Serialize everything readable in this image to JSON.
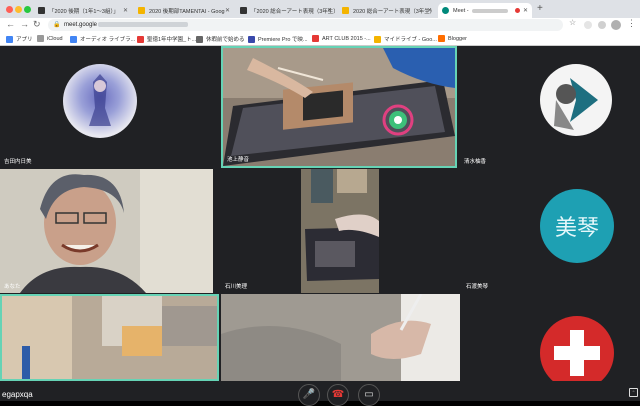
{
  "browser": {
    "tabs": [
      {
        "label": "「2020 後期（1年1〜3組）」",
        "color": "#1a73e8"
      },
      {
        "label": "2020 後期部TAMENTAI - Goog",
        "color": "#f4b400"
      },
      {
        "label": "「2020 総合ーアート表現（3年生）",
        "color": "#1a73e8"
      },
      {
        "label": "2020 総合ーアート表現（3年生）",
        "color": "#f4b400"
      },
      {
        "label": "Meet -",
        "color": "#00897b"
      }
    ],
    "url": "meet.google",
    "bookmarks": [
      {
        "label": "アプリ",
        "color": "#4285f4"
      },
      {
        "label": "iCloud",
        "color": "#999999"
      },
      {
        "label": "オーディオ ライブラ...",
        "color": "#4285f4"
      },
      {
        "label": "聖徳1年中学園_ト...",
        "color": "#e53935"
      },
      {
        "label": "休暇前で始める",
        "color": "#666666"
      },
      {
        "label": "Premiere Pro で映...",
        "color": "#3949ab"
      },
      {
        "label": "ART CLUB 2015 -...",
        "color": "#e53935"
      },
      {
        "label": "マイドライブ - Goo...",
        "color": "#f4b400"
      },
      {
        "label": "Blogger",
        "color": "#ff6d00"
      }
    ]
  },
  "participants": {
    "p1": {
      "name": "吉田内日美"
    },
    "p2": {
      "name": "池上静音"
    },
    "p3": {
      "name": "清水柚香"
    },
    "p4": {
      "name": "あなた"
    },
    "p5": {
      "name": "石川美理"
    },
    "p6": {
      "name": "石渡美琴",
      "avatar_text": "美琴"
    }
  },
  "meeting": {
    "code": "egapxqa"
  },
  "icons": {
    "mic": "mic-icon",
    "hangup": "hangup-icon",
    "camera": "camera-icon"
  },
  "colors": {
    "highlight": "#66d3b5",
    "meet_bg": "#202124",
    "avatar_blue": "#1ea0b3",
    "avatar_red": "#d42a2a"
  }
}
